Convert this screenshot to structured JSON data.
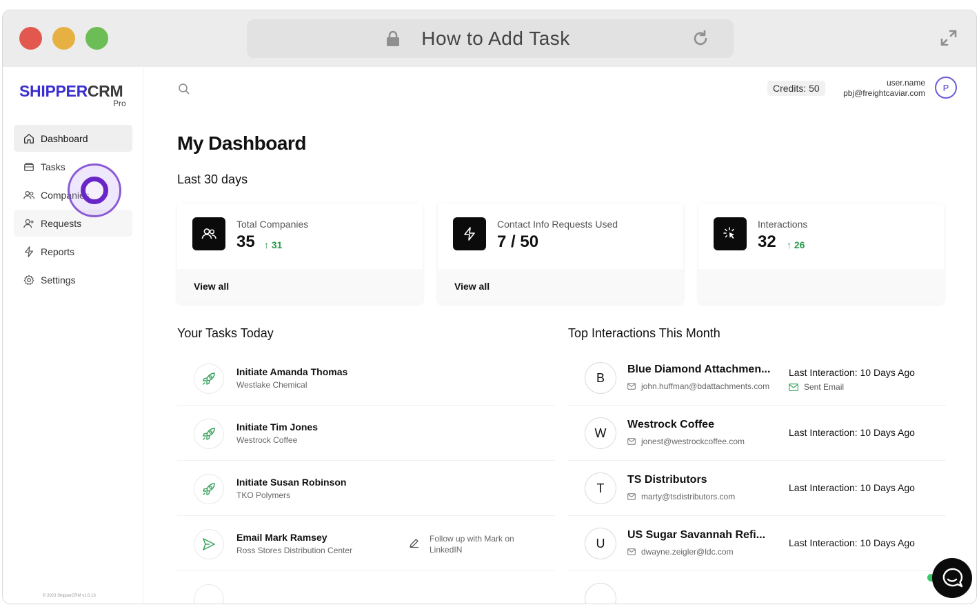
{
  "browser": {
    "url_title": "How to Add Task"
  },
  "sidebar": {
    "logo_primary": "SHIPPER",
    "logo_secondary": "CRM",
    "logo_sub": "Pro",
    "items": [
      {
        "label": "Dashboard",
        "icon": "home-icon"
      },
      {
        "label": "Tasks",
        "icon": "tasks-icon"
      },
      {
        "label": "Companies",
        "icon": "users-icon"
      },
      {
        "label": "Requests",
        "icon": "user-plus-icon"
      },
      {
        "label": "Reports",
        "icon": "bolt-icon"
      },
      {
        "label": "Settings",
        "icon": "gear-icon"
      }
    ],
    "footer": "© 2023 ShipperCRM v1.0.13"
  },
  "header": {
    "credits": "Credits: 50",
    "username": "user.name",
    "email": "pbj@freightcaviar.com",
    "avatar_initial": "P"
  },
  "dashboard": {
    "title": "My Dashboard",
    "period": "Last 30 days",
    "stats": [
      {
        "label": "Total Companies",
        "value": "35",
        "delta": "31",
        "footer": "View all",
        "icon": "users-icon"
      },
      {
        "label": "Contact Info Requests Used",
        "value": "7 / 50",
        "delta": "",
        "footer": "View all",
        "icon": "bolt-icon"
      },
      {
        "label": "Interactions",
        "value": "32",
        "delta": "26",
        "footer": "",
        "icon": "click-icon"
      }
    ]
  },
  "tasks": {
    "title": "Your Tasks Today",
    "items": [
      {
        "title": "Initiate Amanda Thomas",
        "company": "Westlake Chemical",
        "icon": "rocket-icon",
        "note": ""
      },
      {
        "title": "Initiate Tim Jones",
        "company": "Westrock Coffee",
        "icon": "rocket-icon",
        "note": ""
      },
      {
        "title": "Initiate Susan Robinson",
        "company": "TKO Polymers",
        "icon": "rocket-icon",
        "note": ""
      },
      {
        "title": "Email Mark Ramsey",
        "company": "Ross Stores Distribution Center",
        "icon": "send-icon",
        "note": "Follow up with Mark on LinkedIN"
      }
    ]
  },
  "interactions": {
    "title": "Top Interactions This Month",
    "items": [
      {
        "initial": "B",
        "name": "Blue Diamond Attachmen...",
        "email": "john.huffman@bdattachments.com",
        "last": "Last Interaction: 10 Days Ago",
        "action": "Sent Email"
      },
      {
        "initial": "W",
        "name": "Westrock Coffee",
        "email": "jonest@westrockcoffee.com",
        "last": "Last Interaction: 10 Days Ago",
        "action": ""
      },
      {
        "initial": "T",
        "name": "TS Distributors",
        "email": "marty@tsdistributors.com",
        "last": "Last Interaction: 10 Days Ago",
        "action": ""
      },
      {
        "initial": "U",
        "name": "US Sugar Savannah Refi...",
        "email": "dwayne.zeigler@ldc.com",
        "last": "Last Interaction: 10 Days Ago",
        "action": ""
      }
    ]
  },
  "colors": {
    "brand": "#3b2ed0",
    "positive": "#2c9a4d",
    "task_icon": "#35a05a"
  }
}
